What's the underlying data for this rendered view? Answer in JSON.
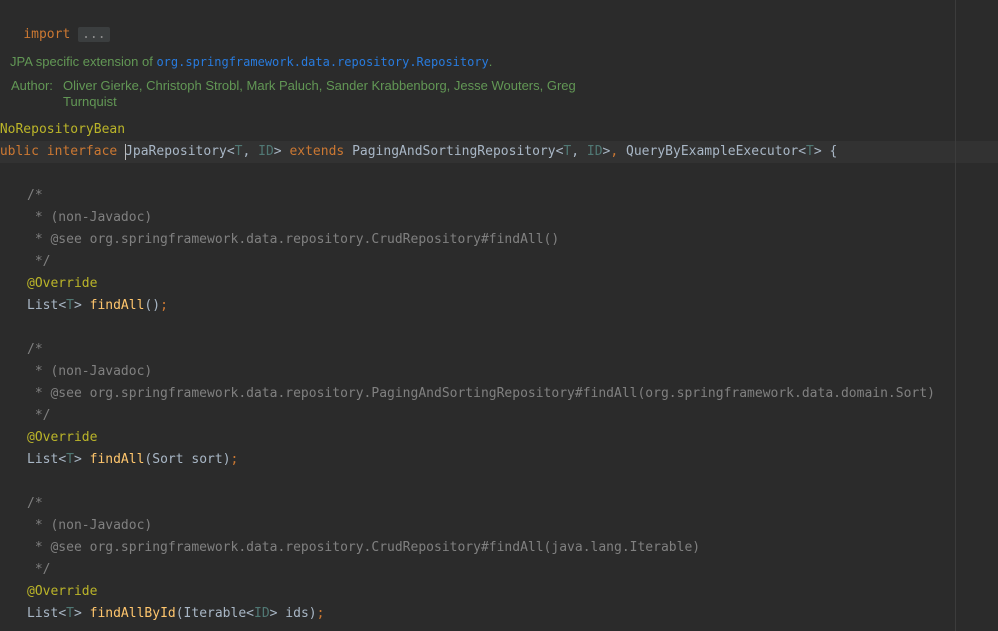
{
  "import_line": {
    "keyword": "import",
    "fold": "..."
  },
  "javadoc": {
    "desc_prefix": "JPA specific extension of ",
    "desc_link": "org.springframework.data.repository.Repository",
    "desc_suffix": ".",
    "author_label": "Author:",
    "authors_line1": "Oliver Gierke, Christoph Strobl, Mark Paluch, Sander Krabbenborg, Jesse Wouters, Greg",
    "authors_line2": "Turnquist"
  },
  "interface_decl": {
    "annotation": "@NoRepositoryBean",
    "kw_public": "public",
    "kw_interface": "interface",
    "name": "JpaRepository",
    "lt1": "<",
    "tp_T1": "T",
    "comma1": ", ",
    "tp_ID1": "ID",
    "gt1": ">",
    "kw_extends": "extends",
    "parent1": "PagingAndSortingRepository",
    "lt2": "<",
    "tp_T2": "T",
    "comma2": ", ",
    "tp_ID2": "ID",
    "gt2": ">",
    "comma3": ",",
    "parent2": "QueryByExampleExecutor",
    "lt3": "<",
    "tp_T3": "T",
    "gt3": ">",
    "brace": "{"
  },
  "methods": [
    {
      "c_open": "/*",
      "c_nonjavadoc": " * (non-Javadoc)",
      "c_see": " * @see org.springframework.data.repository.CrudRepository#findAll()",
      "c_close": " */",
      "annotation": "@Override",
      "ret": "List",
      "lt": "<",
      "tp": "T",
      "gt": ">",
      "name": "findAll",
      "params_pre": "(",
      "params_type_tp": "",
      "params_post": ")",
      "semi": ";"
    },
    {
      "c_open": "/*",
      "c_nonjavadoc": " * (non-Javadoc)",
      "c_see": " * @see org.springframework.data.repository.PagingAndSortingRepository#findAll(org.springframework.data.domain.Sort)",
      "c_close": " */",
      "annotation": "@Override",
      "ret": "List",
      "lt": "<",
      "tp": "T",
      "gt": ">",
      "name": "findAll",
      "params_pre": "(Sort sort)",
      "params_type_tp": "",
      "params_post": "",
      "semi": ";"
    },
    {
      "c_open": "/*",
      "c_nonjavadoc": " * (non-Javadoc)",
      "c_see": " * @see org.springframework.data.repository.CrudRepository#findAll(java.lang.Iterable)",
      "c_close": " */",
      "annotation": "@Override",
      "ret": "List",
      "lt": "<",
      "tp": "T",
      "gt": ">",
      "name": "findAllById",
      "params_pre": "(Iterable<",
      "params_type_tp": "ID",
      "params_post": "> ids)",
      "semi": ";"
    }
  ],
  "colors": {
    "background": "#2b2b2b",
    "keyword": "#cc7832",
    "annotation": "#bbb529",
    "type_param": "#507874",
    "function": "#ffc66d",
    "comment": "#808080",
    "doc_text": "#629755",
    "doc_link": "#287bde"
  }
}
